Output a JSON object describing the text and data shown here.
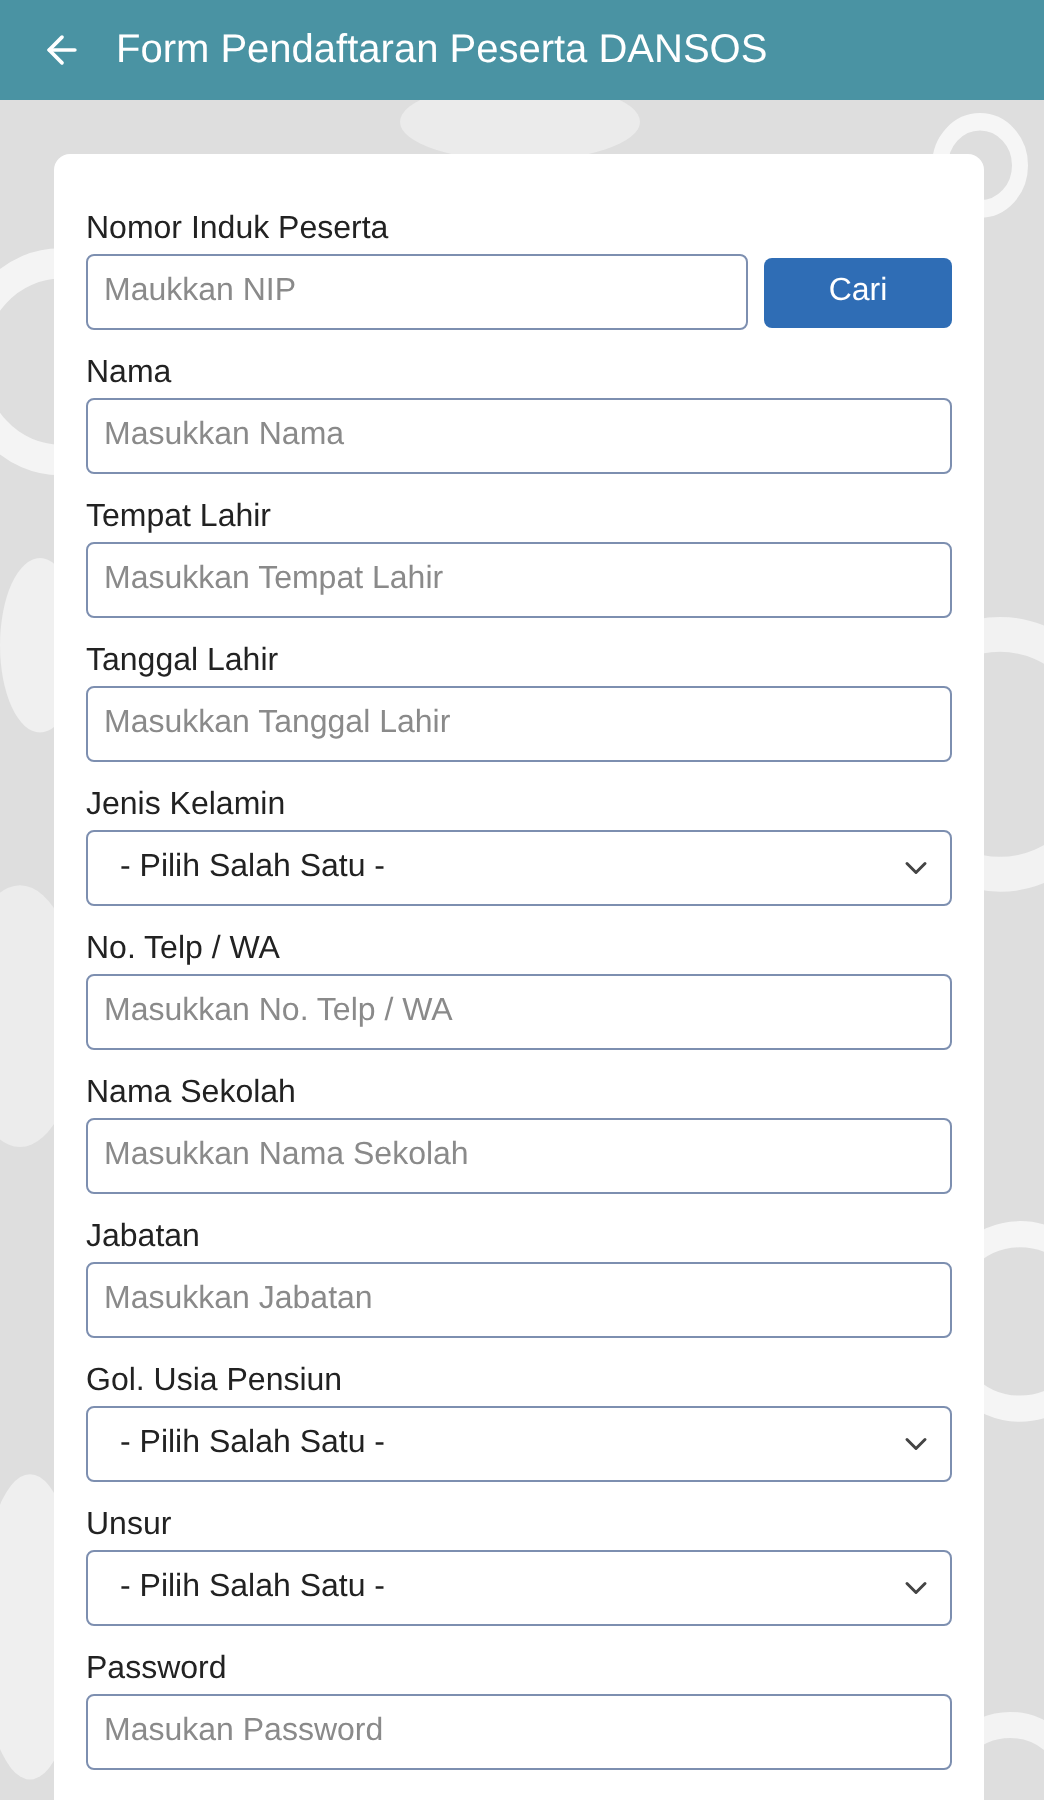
{
  "app_bar": {
    "title": "Form Pendaftaran Peserta DANSOS"
  },
  "fields": [
    {
      "kind": "search",
      "label": "Nomor Induk Peserta",
      "placeholder": "Maukkan NIP",
      "button": "Cari"
    },
    {
      "kind": "text",
      "label": "Nama",
      "placeholder": "Masukkan Nama"
    },
    {
      "kind": "text",
      "label": "Tempat Lahir",
      "placeholder": "Masukkan Tempat Lahir"
    },
    {
      "kind": "text",
      "label": "Tanggal Lahir",
      "placeholder": "Masukkan Tanggal Lahir"
    },
    {
      "kind": "select",
      "label": "Jenis Kelamin",
      "value": "- Pilih Salah Satu -"
    },
    {
      "kind": "text",
      "label": "No. Telp / WA",
      "placeholder": "Masukkan No. Telp / WA"
    },
    {
      "kind": "text",
      "label": "Nama Sekolah",
      "placeholder": "Masukkan Nama Sekolah"
    },
    {
      "kind": "text",
      "label": "Jabatan",
      "placeholder": "Masukkan Jabatan"
    },
    {
      "kind": "select",
      "label": "Gol. Usia Pensiun",
      "value": "- Pilih Salah Satu -"
    },
    {
      "kind": "select",
      "label": "Unsur",
      "value": "- Pilih Salah Satu -"
    },
    {
      "kind": "password",
      "label": "Password",
      "placeholder": "Masukan Password"
    }
  ]
}
